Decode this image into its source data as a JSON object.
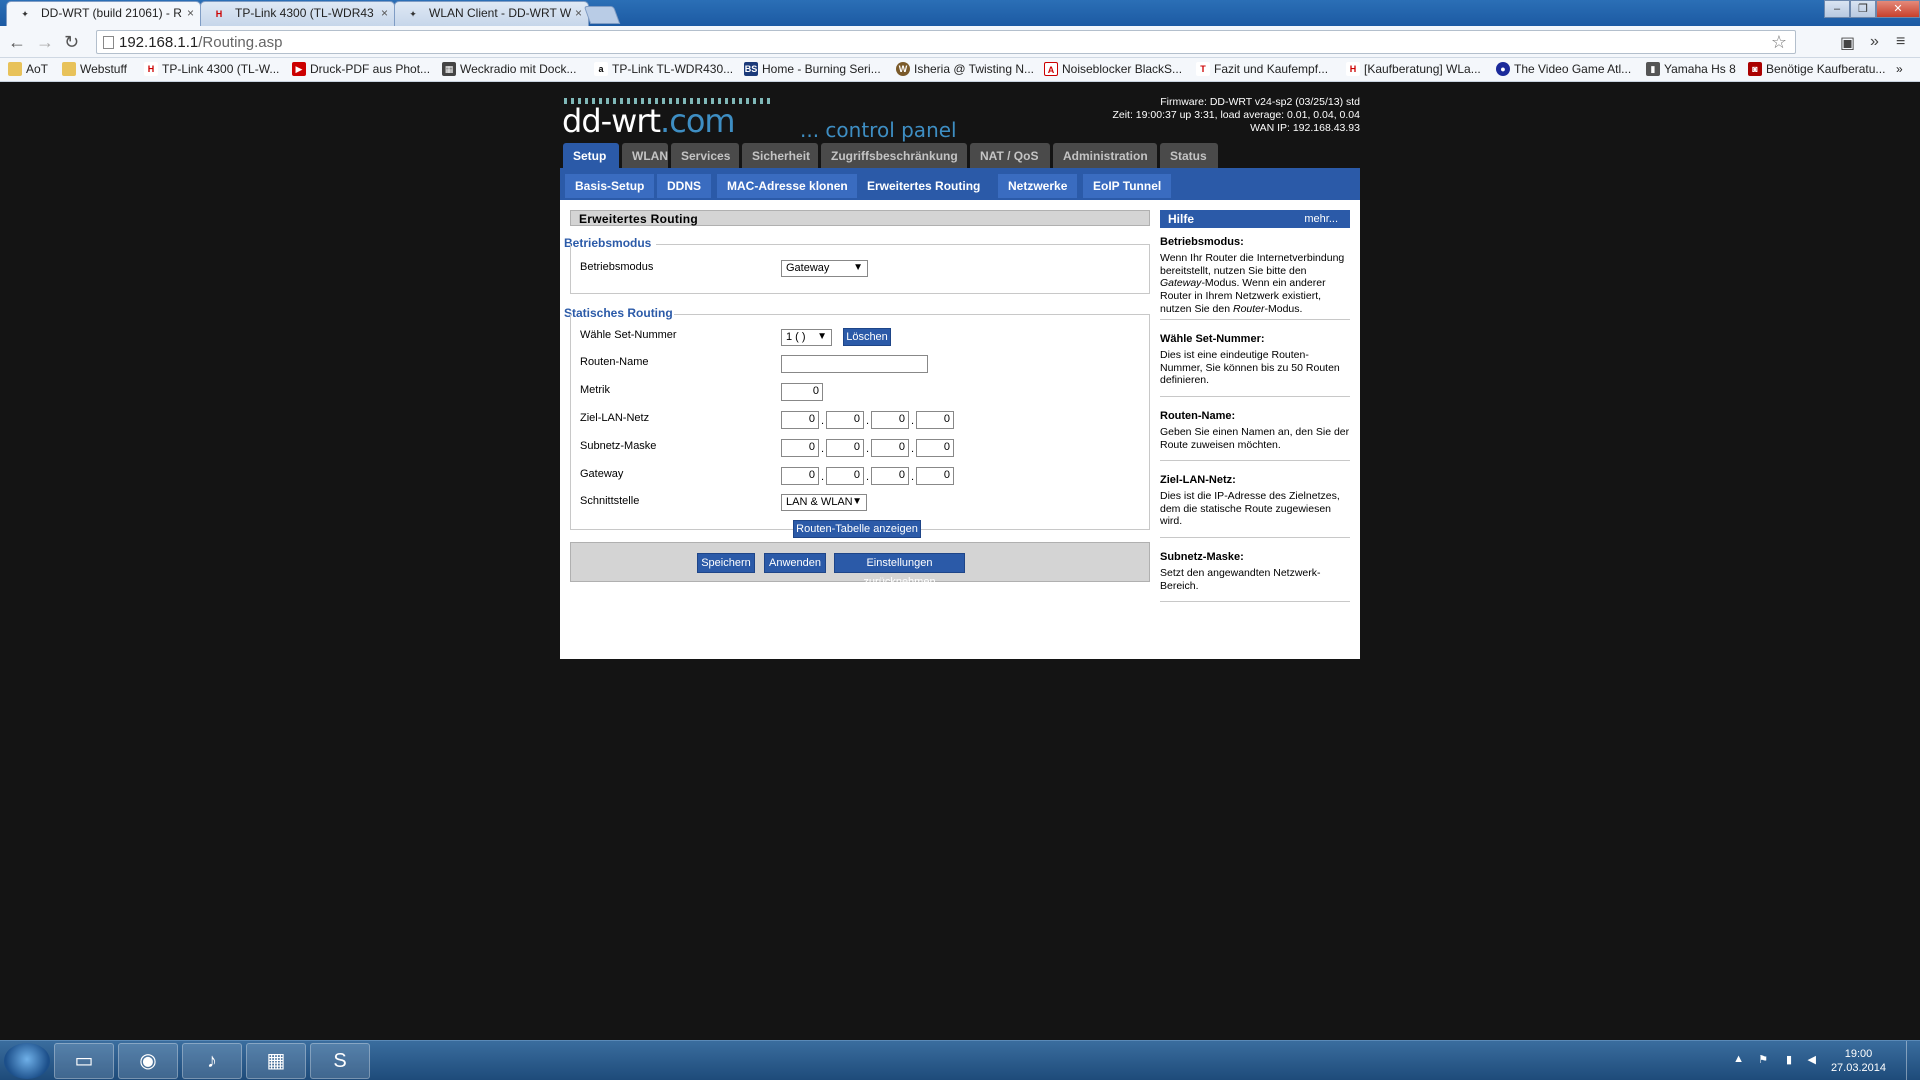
{
  "browser": {
    "tabs": [
      {
        "label": "DD-WRT (build 21061) - R",
        "favicon": "ddwrt-icon"
      },
      {
        "label": "TP-Link 4300 (TL-WDR43",
        "favicon": "heise-icon"
      },
      {
        "label": "WLAN Client - DD-WRT W",
        "favicon": "ddwrt-icon"
      }
    ],
    "url_host": "192.168.1.1",
    "url_path": "/Routing.asp",
    "window_buttons": [
      "–",
      "❐",
      "✕"
    ],
    "bookmarks": [
      "AoT",
      "Webstuff",
      "TP-Link 4300 (TL-W...",
      "Druck-PDF aus Phot...",
      "Weckradio mit Dock...",
      "TP-Link TL-WDR430...",
      "Home - Burning Seri...",
      "Isheria @ Twisting N...",
      "Noiseblocker BlackS...",
      "Fazit und Kaufempf...",
      "[Kaufberatung] WLa...",
      "The Video Game Atl...",
      "Yamaha Hs 8",
      "Benötige Kaufberatu..."
    ],
    "more_bookmarks": "»"
  },
  "router": {
    "logo_main": "dd-wrt",
    "logo_com": ".com",
    "logo_sub": "... control panel",
    "firmware": "Firmware: DD-WRT v24-sp2 (03/25/13) std",
    "time": "Zeit: 19:00:37 up 3:31, load average: 0.01, 0.04, 0.04",
    "wan_ip": "WAN IP: 192.168.43.93",
    "main_tabs": [
      "Setup",
      "WLAN",
      "Services",
      "Sicherheit",
      "Zugriffsbeschränkung",
      "NAT / QoS",
      "Administration",
      "Status"
    ],
    "sub_tabs": [
      "Basis-Setup",
      "DDNS",
      "MAC-Adresse klonen",
      "Erweitertes Routing",
      "Netzwerke",
      "EoIP Tunnel"
    ],
    "panel_title": "Erweitertes Routing",
    "mode_section": "Betriebsmodus",
    "mode_label": "Betriebsmodus",
    "mode_value": "Gateway",
    "static_section": "Statisches Routing",
    "set_label": "Wähle Set-Nummer",
    "set_value": "1 ( )",
    "delete_btn": "Löschen",
    "route_name_label": "Routen-Name",
    "route_name_value": "",
    "metric_label": "Metrik",
    "metric_value": "0",
    "dest_label": "Ziel-LAN-Netz",
    "dest_octets": [
      "0",
      "0",
      "0",
      "0"
    ],
    "mask_label": "Subnetz-Maske",
    "mask_octets": [
      "0",
      "0",
      "0",
      "0"
    ],
    "gw_label": "Gateway",
    "gw_octets": [
      "0",
      "0",
      "0",
      "0"
    ],
    "iface_label": "Schnittstelle",
    "iface_value": "LAN & WLAN",
    "show_table_btn": "Routen-Tabelle anzeigen",
    "save_btn": "Speichern",
    "apply_btn": "Anwenden",
    "reset_btn": "Einstellungen zurücknehmen",
    "help_title": "Hilfe",
    "help_more": "mehr...",
    "help": [
      {
        "title": "Betriebsmodus:",
        "pre": "Wenn Ihr Router die Internetverbindung bereitstellt, nutzen Sie bitte den ",
        "em1": "Gateway",
        "mid": "-Modus. Wenn ein anderer Router in Ihrem Netzwerk existiert, nutzen Sie den ",
        "em2": "Router",
        "post": "-Modus."
      },
      {
        "title": "Wähle Set-Nummer:",
        "text": "Dies ist eine eindeutige Routen-Nummer, Sie können bis zu 50 Routen definieren."
      },
      {
        "title": "Routen-Name:",
        "text": "Geben Sie einen Namen an, den Sie der Route zuweisen möchten."
      },
      {
        "title": "Ziel-LAN-Netz:",
        "text": "Dies ist die IP-Adresse des Zielnetzes, dem die statische Route zugewiesen wird."
      },
      {
        "title": "Subnetz-Maske:",
        "text": "Setzt den angewandten Netzwerk-Bereich."
      }
    ]
  },
  "taskbar": {
    "apps": [
      "windows-start-icon",
      "file-explorer-icon",
      "chrome-icon",
      "itunes-icon",
      "control-panel-icon",
      "skype-icon"
    ],
    "clock_time": "19:00",
    "clock_date": "27.03.2014"
  }
}
